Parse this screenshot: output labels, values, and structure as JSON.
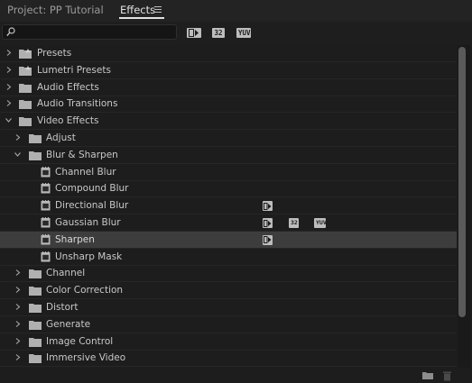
{
  "tabs": {
    "project": "Project: PP Tutorial",
    "effects": "Effects"
  },
  "search": {
    "value": "",
    "placeholder": ""
  },
  "filter_badges": [
    "32",
    "YUV"
  ],
  "tree": [
    {
      "label": "Presets",
      "kind": "folder",
      "level": 0,
      "expanded": false,
      "badges": []
    },
    {
      "label": "Lumetri Presets",
      "kind": "folder",
      "level": 0,
      "expanded": false,
      "badges": []
    },
    {
      "label": "Audio Effects",
      "kind": "folder",
      "level": 0,
      "expanded": false,
      "badges": []
    },
    {
      "label": "Audio Transitions",
      "kind": "folder",
      "level": 0,
      "expanded": false,
      "badges": []
    },
    {
      "label": "Video Effects",
      "kind": "folder",
      "level": 0,
      "expanded": true,
      "badges": []
    },
    {
      "label": "Adjust",
      "kind": "folder",
      "level": 1,
      "expanded": false,
      "badges": []
    },
    {
      "label": "Blur & Sharpen",
      "kind": "folder",
      "level": 1,
      "expanded": true,
      "badges": []
    },
    {
      "label": "Channel Blur",
      "kind": "effect",
      "level": 2,
      "badges": []
    },
    {
      "label": "Compound Blur",
      "kind": "effect",
      "level": 2,
      "badges": []
    },
    {
      "label": "Directional Blur",
      "kind": "effect",
      "level": 2,
      "badges": [
        "accel"
      ]
    },
    {
      "label": "Gaussian Blur",
      "kind": "effect",
      "level": 2,
      "badges": [
        "accel",
        "32",
        "YUV"
      ]
    },
    {
      "label": "Sharpen",
      "kind": "effect",
      "level": 2,
      "badges": [
        "accel"
      ],
      "selected": true
    },
    {
      "label": "Unsharp Mask",
      "kind": "effect",
      "level": 2,
      "badges": []
    },
    {
      "label": "Channel",
      "kind": "folder",
      "level": 1,
      "expanded": false,
      "badges": []
    },
    {
      "label": "Color Correction",
      "kind": "folder",
      "level": 1,
      "expanded": false,
      "badges": []
    },
    {
      "label": "Distort",
      "kind": "folder",
      "level": 1,
      "expanded": false,
      "badges": []
    },
    {
      "label": "Generate",
      "kind": "folder",
      "level": 1,
      "expanded": false,
      "badges": []
    },
    {
      "label": "Image Control",
      "kind": "folder",
      "level": 1,
      "expanded": false,
      "badges": []
    },
    {
      "label": "Immersive Video",
      "kind": "folder",
      "level": 1,
      "expanded": false,
      "badges": []
    }
  ],
  "colors": {
    "panel_bg": "#1d1d1d",
    "selected_row": "#3d3d3d",
    "text": "#c8c8c8",
    "accent_text": "#e2e2e2"
  }
}
